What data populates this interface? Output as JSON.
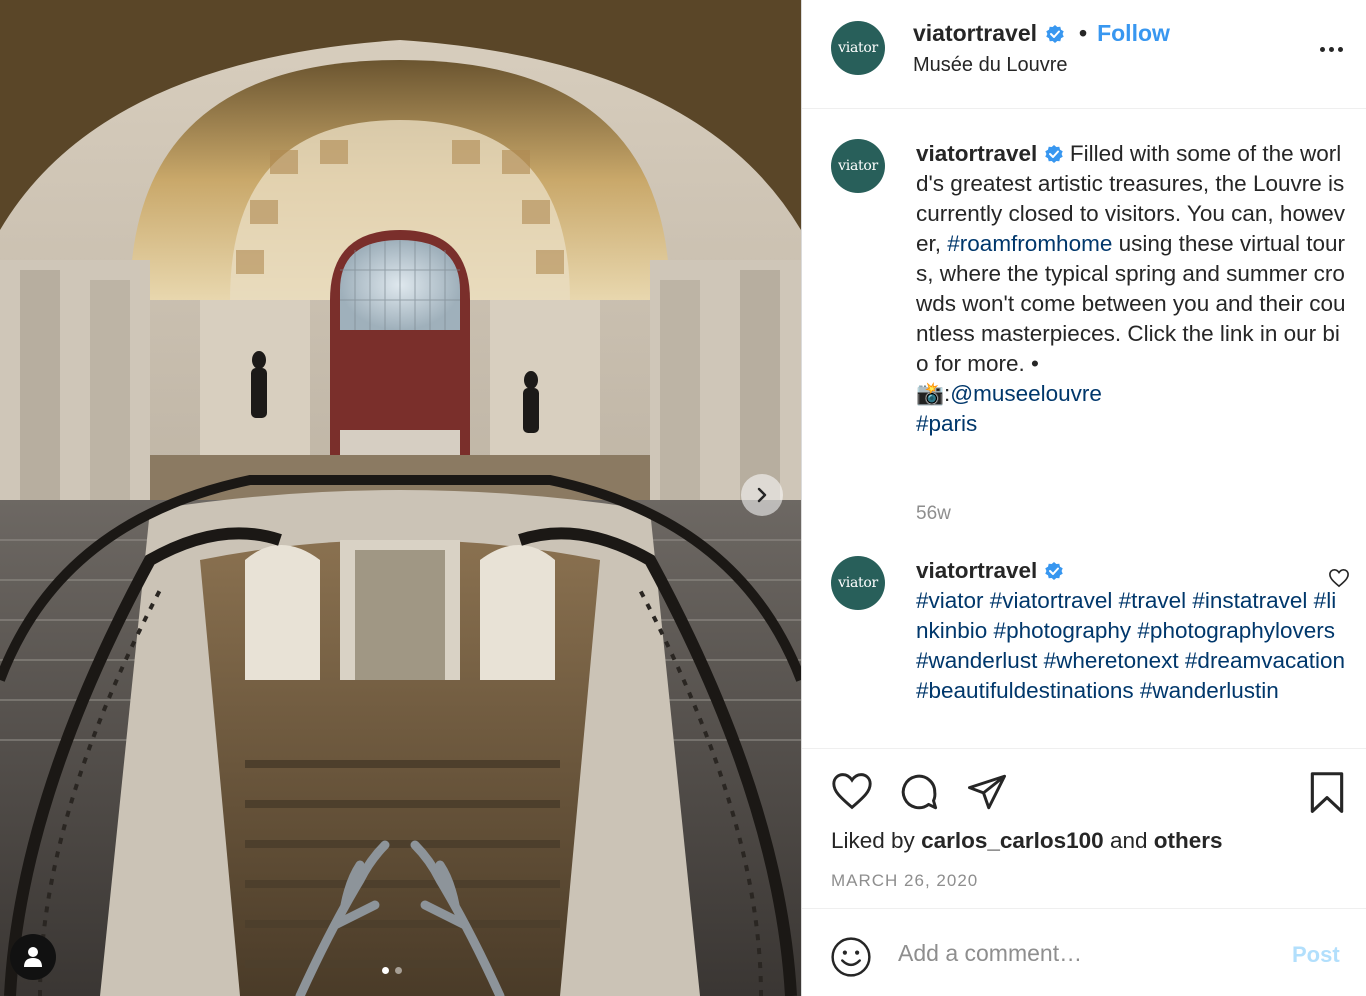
{
  "post": {
    "author": "viatortravel",
    "avatar_text": "viator",
    "follow_label": "Follow",
    "separator": "•",
    "location": "Musée du Louvre"
  },
  "comments": [
    {
      "username": "viatortravel",
      "text_before": "Filled with some of the world's greatest artistic treasures, the Louvre is currently closed to visitors. You can, however, ",
      "tag1": "#roamfromhome",
      "text_middle": " using these virtual tours, where the typical spring and summer crowds won't come between you and their countless masterpieces. Click the link in our bio for more. • ",
      "emoji": "📸",
      "text_colon": ":",
      "mention": "@museelouvre",
      "tag2": "#paris",
      "timestamp": "56w"
    },
    {
      "username": "viatortravel",
      "hashtags": "#viator #viatortravel #travel #instatravel #linkinbio #photography #photographylovers #wanderlust #wheretonext #dreamvacation #beautifuldestinations #wanderlustin"
    }
  ],
  "actions": {
    "liked_prefix": "Liked by ",
    "liked_user": "carlos_carlos100",
    "liked_and": " and ",
    "liked_others": "others",
    "date": "MARCH 26, 2020"
  },
  "comment_box": {
    "placeholder": "Add a comment…",
    "post_label": "Post"
  },
  "carousel": {
    "slide_count": 2,
    "active_slide": 1
  },
  "colors": {
    "accent": "#3897f0",
    "link": "#00376b",
    "avatar_bg": "#285f5a",
    "post_disabled": "#b2dffc"
  },
  "icons": [
    "chevron-right-icon",
    "user-tag-icon",
    "verified-badge-icon",
    "more-options-icon",
    "heart-icon",
    "comment-icon",
    "share-icon",
    "bookmark-icon",
    "emoji-icon"
  ]
}
